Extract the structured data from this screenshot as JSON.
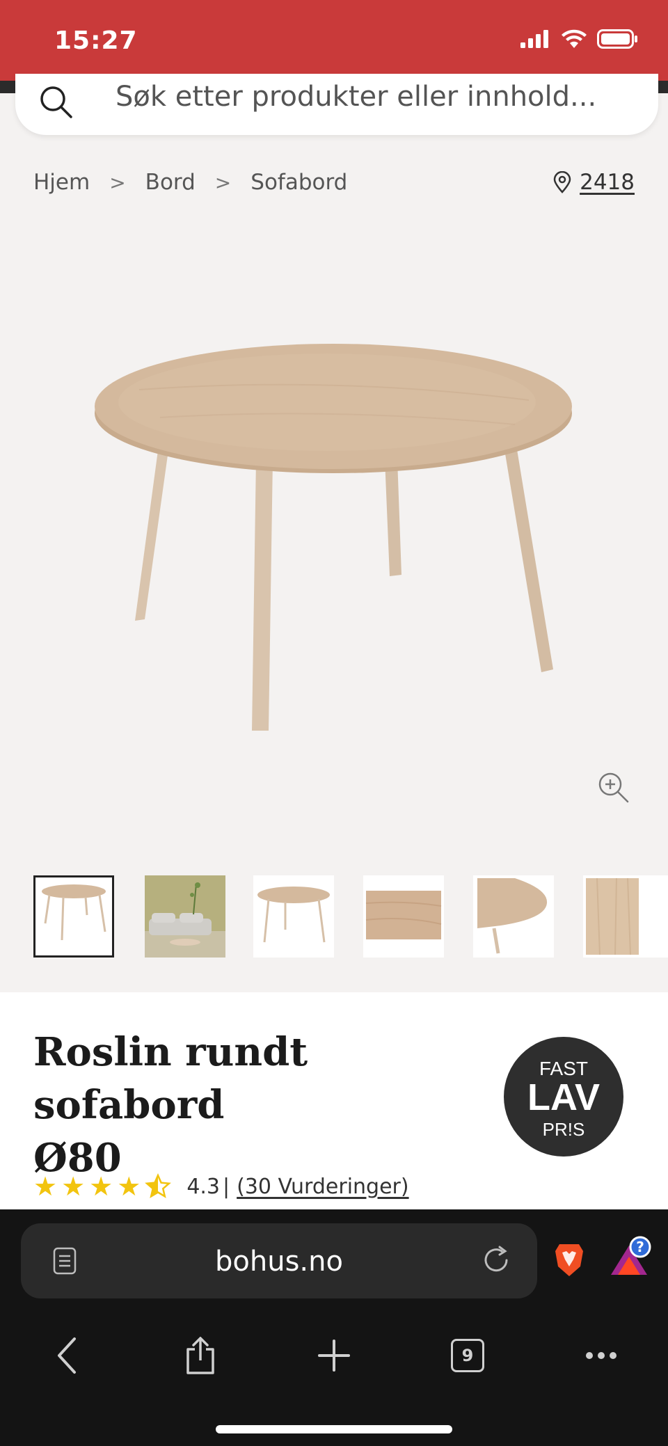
{
  "status_bar": {
    "time": "15:27"
  },
  "search": {
    "placeholder": "Søk etter produkter eller innhold..."
  },
  "breadcrumb": {
    "items": [
      "Hjem",
      "Bord",
      "Sofabord"
    ],
    "separator": ">"
  },
  "location": {
    "code": "2418"
  },
  "product": {
    "title_line1": "Roslin rundt sofabord",
    "title_line2": "Ø80",
    "badge": {
      "line1": "FAST",
      "line2": "LAV",
      "line3": "PR!S"
    },
    "rating": {
      "stars": 4.5,
      "value": "4.3",
      "separator": "|",
      "reviews": "(30 Vurderinger)"
    },
    "thumbnails": 6,
    "active_thumbnail": 1
  },
  "browser": {
    "url": "bohus.no",
    "tab_count": "9",
    "badge": "?"
  },
  "colors": {
    "brand_red": "#c93a3a",
    "star": "#f2c40f",
    "badge_bg": "#2e2e2e",
    "wood": "#d3b99e"
  },
  "icons": [
    "search-icon",
    "location-pin-icon",
    "zoom-in-icon",
    "reader-icon",
    "reload-icon",
    "brave-icon",
    "rewards-icon",
    "back-icon",
    "share-icon",
    "plus-icon",
    "tabs-icon",
    "more-icon"
  ]
}
